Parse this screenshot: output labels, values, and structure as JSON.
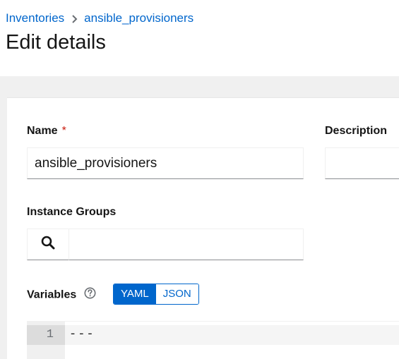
{
  "breadcrumb": {
    "items": [
      {
        "label": "Inventories"
      },
      {
        "label": "ansible_provisioners"
      }
    ]
  },
  "page": {
    "title": "Edit details"
  },
  "form": {
    "name": {
      "label": "Name",
      "required_mark": "*",
      "value": "ansible_provisioners"
    },
    "description": {
      "label": "Description",
      "value": ""
    },
    "instance_groups": {
      "label": "Instance Groups",
      "value": "",
      "search_icon": "search-icon"
    },
    "variables": {
      "label": "Variables",
      "help_icon": "question-circle-icon",
      "toggle": {
        "yaml_label": "YAML",
        "json_label": "JSON",
        "selected": "YAML"
      },
      "editor": {
        "line_number": "1",
        "line_text": "---"
      }
    }
  },
  "colors": {
    "link": "#0066cc",
    "required": "#c9190b",
    "toggle_active_bg": "#0066cc",
    "band_bg": "#f0f0f0"
  }
}
